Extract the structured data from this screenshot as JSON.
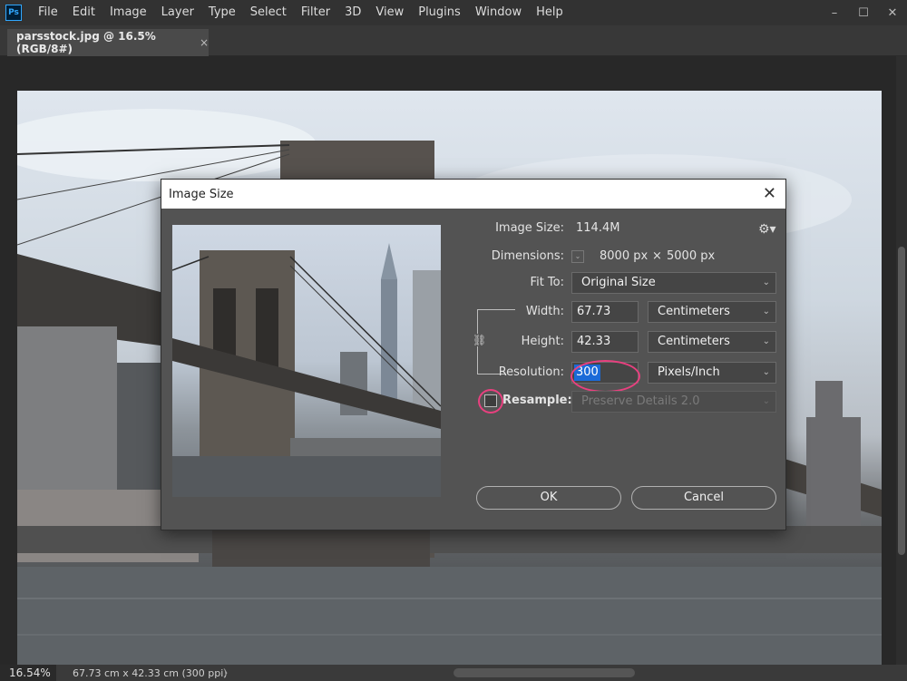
{
  "app": {
    "logo": "Ps"
  },
  "menubar": {
    "items": [
      "File",
      "Edit",
      "Image",
      "Layer",
      "Type",
      "Select",
      "Filter",
      "3D",
      "View",
      "Plugins",
      "Window",
      "Help"
    ],
    "window_controls": [
      "–",
      "☐",
      "✕"
    ]
  },
  "document_tab": {
    "title": "parsstock.jpg @ 16.5% (RGB/8#)",
    "close": "×"
  },
  "status_bar": {
    "zoom": "16.54%",
    "doc_info": "67.73 cm x 42.33 cm (300 ppi)",
    "arrow": "〉"
  },
  "dialog": {
    "title": "Image Size",
    "close": "✕",
    "image_size_label": "Image Size:",
    "image_size_value": "114.4M",
    "dimensions_label": "Dimensions:",
    "dimensions_width": "8000 px",
    "dimensions_x": "×",
    "dimensions_height": "5000 px",
    "fit_to_label": "Fit To:",
    "fit_to_value": "Original Size",
    "width_label": "Width:",
    "width_value": "67.73",
    "width_unit": "Centimeters",
    "height_label": "Height:",
    "height_value": "42.33",
    "height_unit": "Centimeters",
    "resolution_label": "Resolution:",
    "resolution_value": "300",
    "resolution_unit": "Pixels/Inch",
    "resample_label": "Resample:",
    "resample_checked": false,
    "resample_method": "Preserve Details 2.0",
    "ok_label": "OK",
    "cancel_label": "Cancel"
  },
  "colors": {
    "highlight_circle": "#e8407f",
    "selection": "#1b6ad8",
    "ps_logo": "#31a8ff"
  }
}
